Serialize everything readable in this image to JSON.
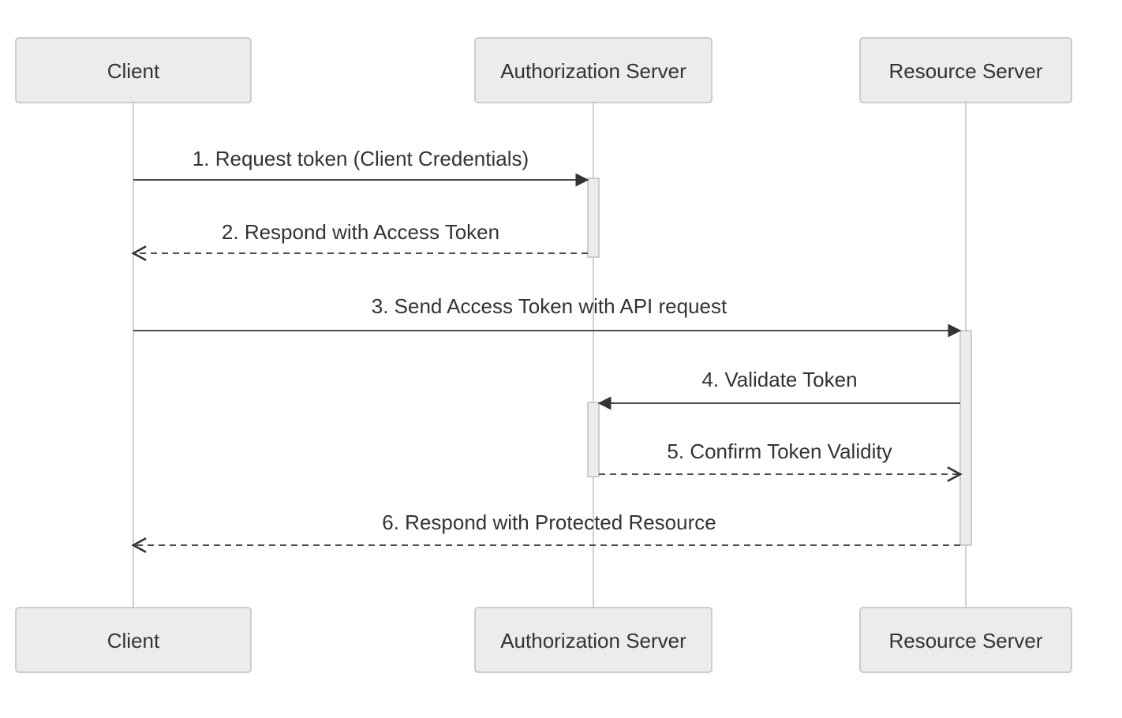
{
  "diagram": {
    "type": "sequence",
    "actors": [
      {
        "id": "client",
        "label": "Client"
      },
      {
        "id": "auth",
        "label": "Authorization Server"
      },
      {
        "id": "res",
        "label": "Resource Server"
      }
    ],
    "messages": [
      {
        "n": 1,
        "from": "client",
        "to": "auth",
        "style": "solid",
        "label": "1. Request token (Client Credentials)"
      },
      {
        "n": 2,
        "from": "auth",
        "to": "client",
        "style": "dashed",
        "label": "2. Respond with Access Token"
      },
      {
        "n": 3,
        "from": "client",
        "to": "res",
        "style": "solid",
        "label": "3. Send Access Token with API request"
      },
      {
        "n": 4,
        "from": "res",
        "to": "auth",
        "style": "solid",
        "label": "4. Validate Token"
      },
      {
        "n": 5,
        "from": "auth",
        "to": "res",
        "style": "dashed",
        "label": "5. Confirm Token Validity"
      },
      {
        "n": 6,
        "from": "res",
        "to": "client",
        "style": "dashed",
        "label": "6. Respond with Protected Resource"
      }
    ]
  }
}
